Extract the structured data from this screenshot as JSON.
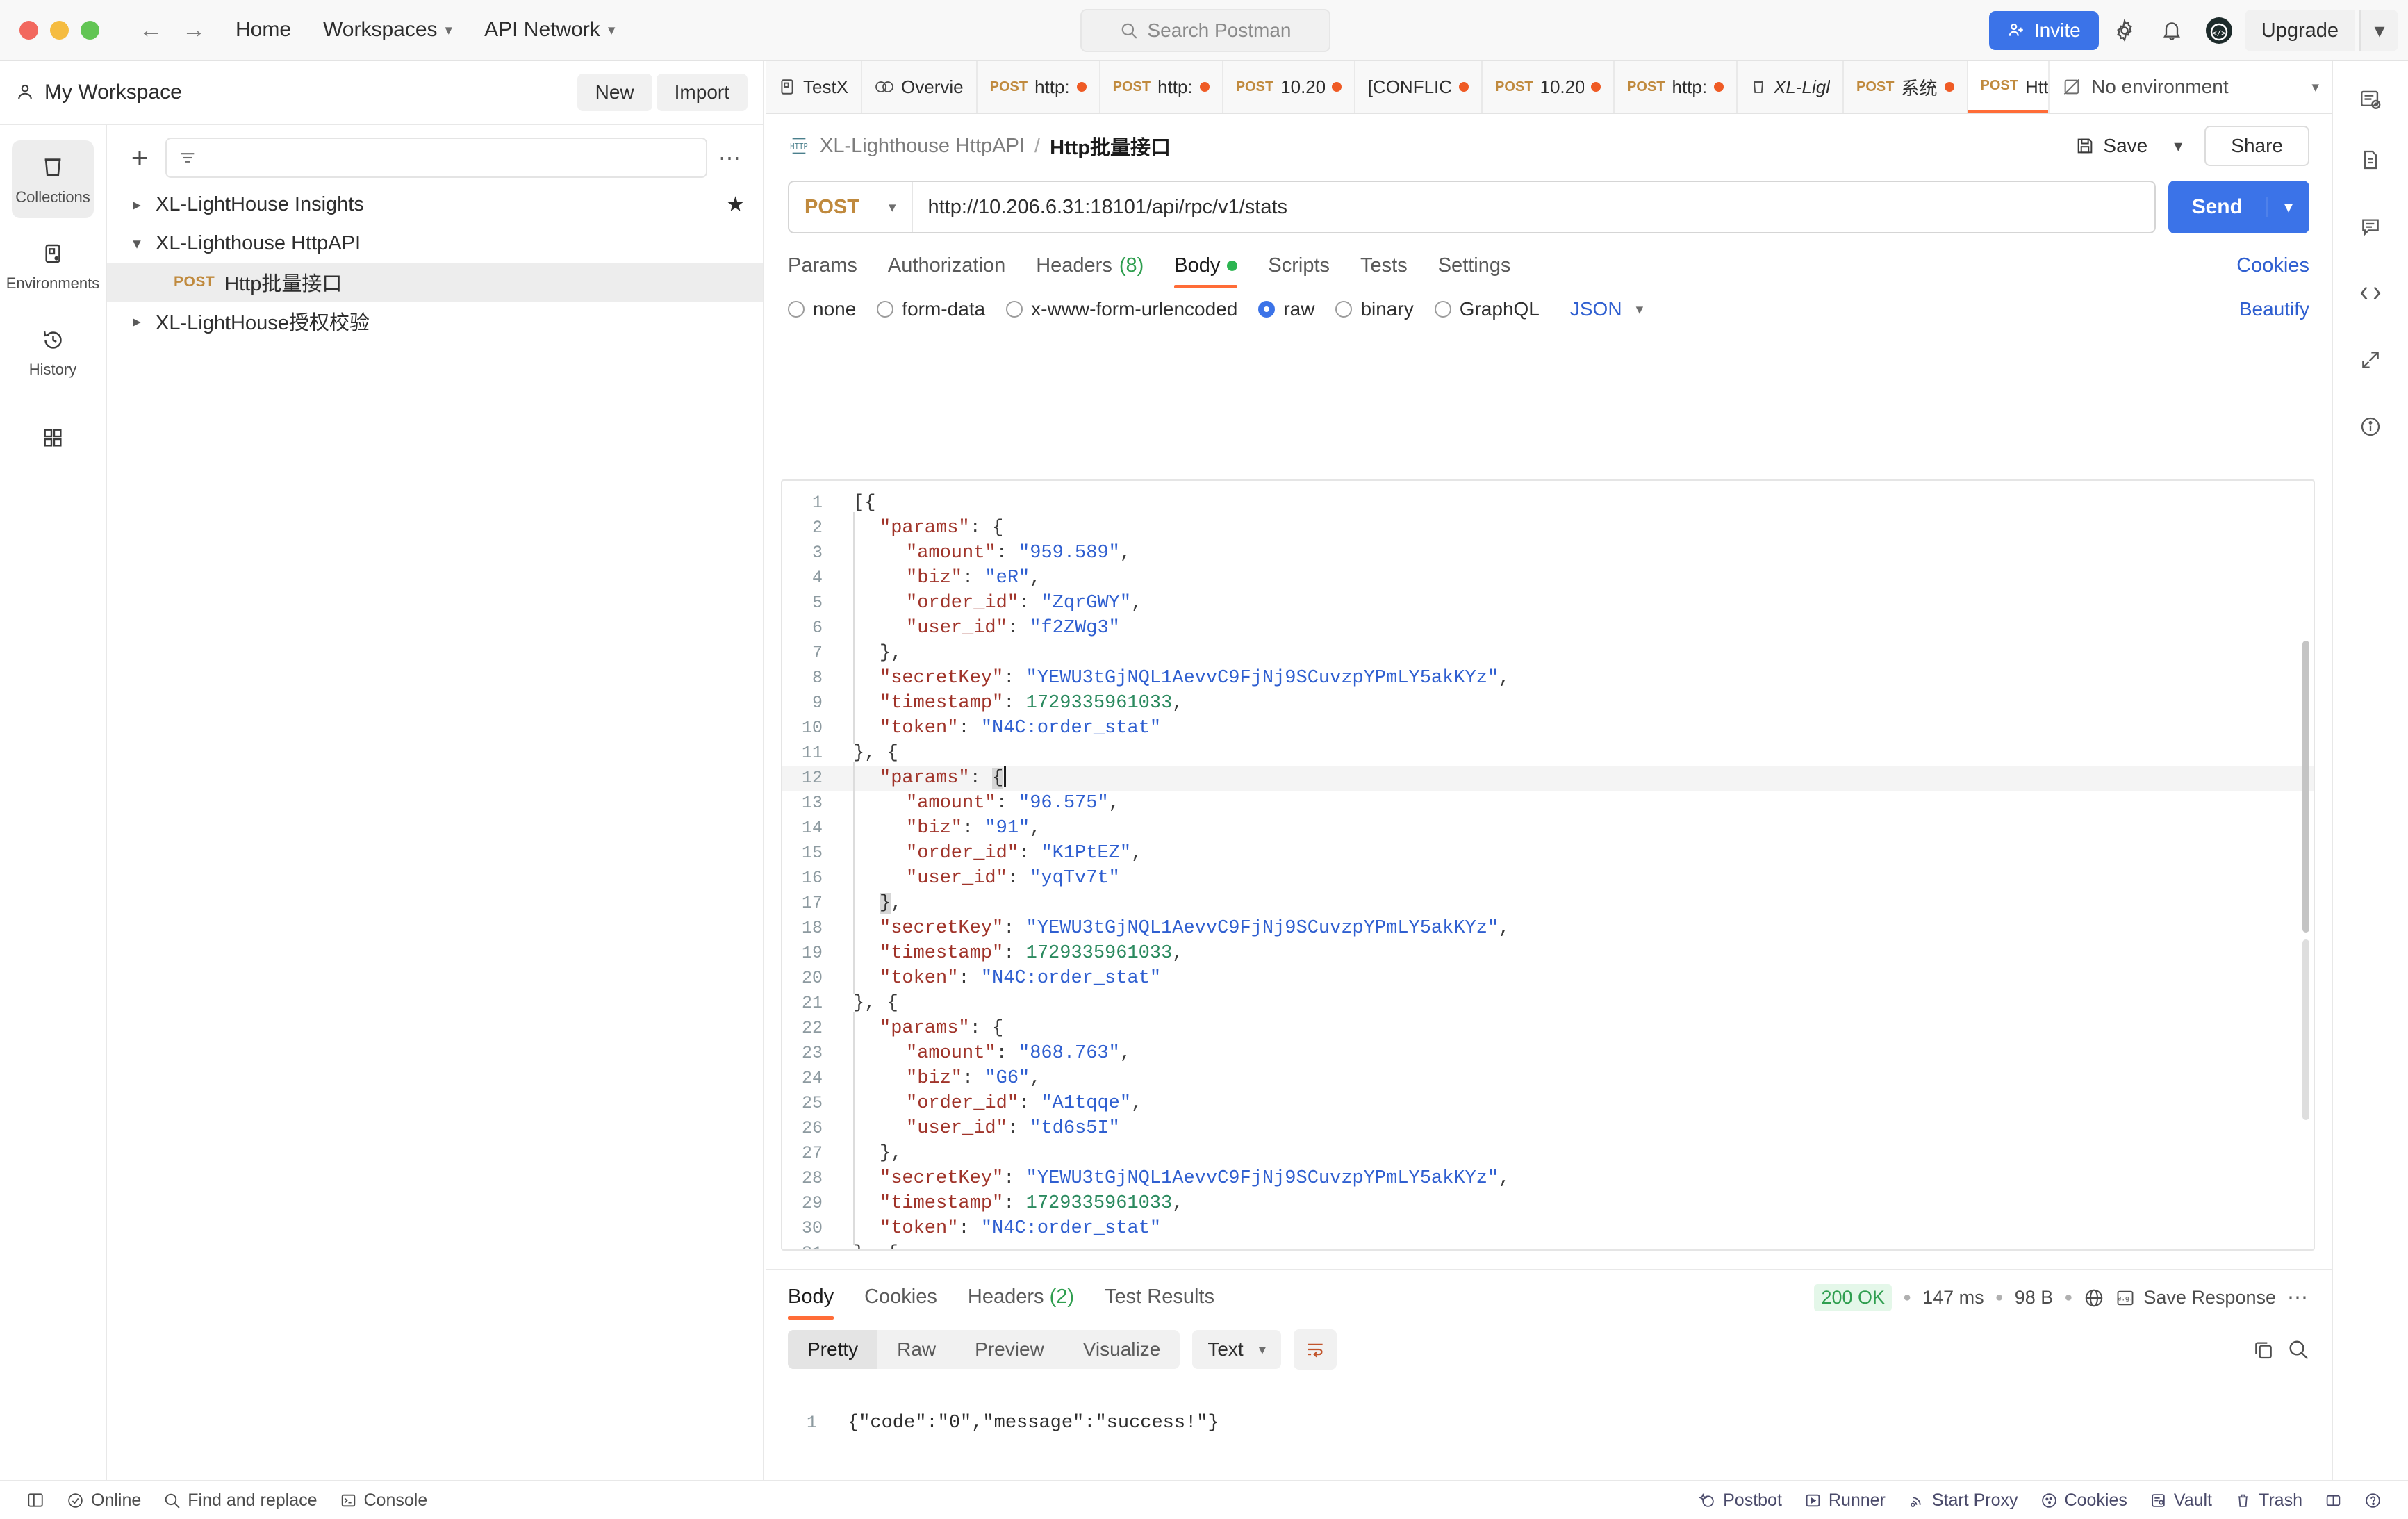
{
  "topbar": {
    "nav_back": "back-arrow",
    "nav_forward": "forward-arrow",
    "home": "Home",
    "workspaces": "Workspaces",
    "api_network": "API Network",
    "search_placeholder": "Search Postman",
    "invite": "Invite",
    "upgrade": "Upgrade"
  },
  "sidebar": {
    "workspace": "My Workspace",
    "new_button": "New",
    "import_button": "Import",
    "rail": [
      {
        "label": "Collections",
        "icon": "collections-icon",
        "active": true
      },
      {
        "label": "Environments",
        "icon": "environments-icon",
        "active": false
      },
      {
        "label": "History",
        "icon": "history-icon",
        "active": false
      },
      {
        "label": "",
        "icon": "apps-icon",
        "active": false
      }
    ],
    "filter_placeholder": "",
    "tree": [
      {
        "type": "collection",
        "label": "XL-LightHouse Insights",
        "expanded": false,
        "starred": true,
        "selected": false
      },
      {
        "type": "collection",
        "label": "XL-Lighthouse HttpAPI",
        "expanded": true,
        "starred": false,
        "selected": false
      },
      {
        "type": "request",
        "method": "POST",
        "label": "Http批量接口",
        "selected": true
      },
      {
        "type": "collection",
        "label": "XL-LightHouse授权校验",
        "expanded": false,
        "starred": false,
        "selected": false
      }
    ]
  },
  "tabs": [
    {
      "icon": "request-icon",
      "method": "",
      "label": "TestX",
      "dirty": false,
      "active": false
    },
    {
      "icon": "overview-icon",
      "method": "",
      "label": "Overvie",
      "dirty": false,
      "active": false
    },
    {
      "icon": "",
      "method": "POST",
      "label": "http:",
      "dirty": true,
      "active": false
    },
    {
      "icon": "",
      "method": "POST",
      "label": "http:",
      "dirty": true,
      "active": false
    },
    {
      "icon": "",
      "method": "POST",
      "label": "10.20",
      "dirty": true,
      "active": false
    },
    {
      "icon": "",
      "method": "",
      "label": "[CONFLIC",
      "dirty": true,
      "active": false
    },
    {
      "icon": "",
      "method": "POST",
      "label": "10.20",
      "dirty": true,
      "active": false
    },
    {
      "icon": "",
      "method": "POST",
      "label": "http:",
      "dirty": true,
      "active": false
    },
    {
      "icon": "collection-icon",
      "method": "",
      "label": "XL-Ligl",
      "dirty": false,
      "active": false
    },
    {
      "icon": "",
      "method": "POST",
      "label": "系统",
      "dirty": true,
      "active": false
    },
    {
      "icon": "",
      "method": "POST",
      "label": "Http批",
      "dirty": true,
      "active": true
    }
  ],
  "environment": {
    "label": "No environment"
  },
  "request": {
    "breadcrumb_collection": "XL-Lighthouse HttpAPI",
    "breadcrumb_separator": "/",
    "breadcrumb_request": "Http批量接口",
    "save_label": "Save",
    "share_label": "Share",
    "method": "POST",
    "url": "http://10.206.6.31:18101/api/rpc/v1/stats",
    "send_label": "Send",
    "tabs": [
      {
        "label": "Params",
        "active": false
      },
      {
        "label": "Authorization",
        "active": false
      },
      {
        "label": "Headers",
        "count": "(8)",
        "active": false
      },
      {
        "label": "Body",
        "dirty": true,
        "active": true
      },
      {
        "label": "Scripts",
        "active": false
      },
      {
        "label": "Tests",
        "active": false
      },
      {
        "label": "Settings",
        "active": false
      }
    ],
    "cookies_link": "Cookies",
    "body_types": [
      {
        "label": "none",
        "selected": false
      },
      {
        "label": "form-data",
        "selected": false
      },
      {
        "label": "x-www-form-urlencoded",
        "selected": false
      },
      {
        "label": "raw",
        "selected": true
      },
      {
        "label": "binary",
        "selected": false
      },
      {
        "label": "GraphQL",
        "selected": false
      }
    ],
    "raw_format": "JSON",
    "beautify_label": "Beautify"
  },
  "body_code": [
    {
      "n": 1,
      "indent": 0,
      "guide": false,
      "tokens": [
        {
          "t": "p",
          "v": "[{"
        }
      ]
    },
    {
      "n": 2,
      "indent": 1,
      "guide": true,
      "tokens": [
        {
          "t": "k",
          "v": "\"params\""
        },
        {
          "t": "p",
          "v": ": {"
        }
      ]
    },
    {
      "n": 3,
      "indent": 2,
      "guide": true,
      "tokens": [
        {
          "t": "k",
          "v": "\"amount\""
        },
        {
          "t": "p",
          "v": ": "
        },
        {
          "t": "s",
          "v": "\"959.589\""
        },
        {
          "t": "p",
          "v": ","
        }
      ]
    },
    {
      "n": 4,
      "indent": 2,
      "guide": true,
      "tokens": [
        {
          "t": "k",
          "v": "\"biz\""
        },
        {
          "t": "p",
          "v": ": "
        },
        {
          "t": "s",
          "v": "\"eR\""
        },
        {
          "t": "p",
          "v": ","
        }
      ]
    },
    {
      "n": 5,
      "indent": 2,
      "guide": true,
      "tokens": [
        {
          "t": "k",
          "v": "\"order_id\""
        },
        {
          "t": "p",
          "v": ": "
        },
        {
          "t": "s",
          "v": "\"ZqrGWY\""
        },
        {
          "t": "p",
          "v": ","
        }
      ]
    },
    {
      "n": 6,
      "indent": 2,
      "guide": true,
      "tokens": [
        {
          "t": "k",
          "v": "\"user_id\""
        },
        {
          "t": "p",
          "v": ": "
        },
        {
          "t": "s",
          "v": "\"f2ZWg3\""
        }
      ]
    },
    {
      "n": 7,
      "indent": 1,
      "guide": true,
      "tokens": [
        {
          "t": "p",
          "v": "},"
        }
      ]
    },
    {
      "n": 8,
      "indent": 1,
      "guide": true,
      "tokens": [
        {
          "t": "k",
          "v": "\"secretKey\""
        },
        {
          "t": "p",
          "v": ": "
        },
        {
          "t": "s",
          "v": "\"YEWU3tGjNQL1AevvC9FjNj9SCuvzpYPmLY5akKYz\""
        },
        {
          "t": "p",
          "v": ","
        }
      ]
    },
    {
      "n": 9,
      "indent": 1,
      "guide": true,
      "tokens": [
        {
          "t": "k",
          "v": "\"timestamp\""
        },
        {
          "t": "p",
          "v": ": "
        },
        {
          "t": "n",
          "v": "1729335961033"
        },
        {
          "t": "p",
          "v": ","
        }
      ]
    },
    {
      "n": 10,
      "indent": 1,
      "guide": true,
      "tokens": [
        {
          "t": "k",
          "v": "\"token\""
        },
        {
          "t": "p",
          "v": ": "
        },
        {
          "t": "s",
          "v": "\"N4C:order_stat\""
        }
      ]
    },
    {
      "n": 11,
      "indent": 0,
      "guide": false,
      "tokens": [
        {
          "t": "p",
          "v": "}, {"
        }
      ]
    },
    {
      "n": 12,
      "indent": 1,
      "guide": true,
      "highlight": true,
      "cursor": true,
      "tokens": [
        {
          "t": "k",
          "v": "\"params\""
        },
        {
          "t": "p",
          "v": ": "
        },
        {
          "t": "sel",
          "v": "{"
        }
      ]
    },
    {
      "n": 13,
      "indent": 2,
      "guide": true,
      "tokens": [
        {
          "t": "k",
          "v": "\"amount\""
        },
        {
          "t": "p",
          "v": ": "
        },
        {
          "t": "s",
          "v": "\"96.575\""
        },
        {
          "t": "p",
          "v": ","
        }
      ]
    },
    {
      "n": 14,
      "indent": 2,
      "guide": true,
      "tokens": [
        {
          "t": "k",
          "v": "\"biz\""
        },
        {
          "t": "p",
          "v": ": "
        },
        {
          "t": "s",
          "v": "\"91\""
        },
        {
          "t": "p",
          "v": ","
        }
      ]
    },
    {
      "n": 15,
      "indent": 2,
      "guide": true,
      "tokens": [
        {
          "t": "k",
          "v": "\"order_id\""
        },
        {
          "t": "p",
          "v": ": "
        },
        {
          "t": "s",
          "v": "\"K1PtEZ\""
        },
        {
          "t": "p",
          "v": ","
        }
      ]
    },
    {
      "n": 16,
      "indent": 2,
      "guide": true,
      "tokens": [
        {
          "t": "k",
          "v": "\"user_id\""
        },
        {
          "t": "p",
          "v": ": "
        },
        {
          "t": "s",
          "v": "\"yqTv7t\""
        }
      ]
    },
    {
      "n": 17,
      "indent": 1,
      "guide": true,
      "tokens": [
        {
          "t": "sel",
          "v": "}"
        },
        {
          "t": "p",
          "v": ","
        }
      ]
    },
    {
      "n": 18,
      "indent": 1,
      "guide": true,
      "tokens": [
        {
          "t": "k",
          "v": "\"secretKey\""
        },
        {
          "t": "p",
          "v": ": "
        },
        {
          "t": "s",
          "v": "\"YEWU3tGjNQL1AevvC9FjNj9SCuvzpYPmLY5akKYz\""
        },
        {
          "t": "p",
          "v": ","
        }
      ]
    },
    {
      "n": 19,
      "indent": 1,
      "guide": true,
      "tokens": [
        {
          "t": "k",
          "v": "\"timestamp\""
        },
        {
          "t": "p",
          "v": ": "
        },
        {
          "t": "n",
          "v": "1729335961033"
        },
        {
          "t": "p",
          "v": ","
        }
      ]
    },
    {
      "n": 20,
      "indent": 1,
      "guide": true,
      "tokens": [
        {
          "t": "k",
          "v": "\"token\""
        },
        {
          "t": "p",
          "v": ": "
        },
        {
          "t": "s",
          "v": "\"N4C:order_stat\""
        }
      ]
    },
    {
      "n": 21,
      "indent": 0,
      "guide": false,
      "tokens": [
        {
          "t": "p",
          "v": "}, {"
        }
      ]
    },
    {
      "n": 22,
      "indent": 1,
      "guide": true,
      "tokens": [
        {
          "t": "k",
          "v": "\"params\""
        },
        {
          "t": "p",
          "v": ": {"
        }
      ]
    },
    {
      "n": 23,
      "indent": 2,
      "guide": true,
      "tokens": [
        {
          "t": "k",
          "v": "\"amount\""
        },
        {
          "t": "p",
          "v": ": "
        },
        {
          "t": "s",
          "v": "\"868.763\""
        },
        {
          "t": "p",
          "v": ","
        }
      ]
    },
    {
      "n": 24,
      "indent": 2,
      "guide": true,
      "tokens": [
        {
          "t": "k",
          "v": "\"biz\""
        },
        {
          "t": "p",
          "v": ": "
        },
        {
          "t": "s",
          "v": "\"G6\""
        },
        {
          "t": "p",
          "v": ","
        }
      ]
    },
    {
      "n": 25,
      "indent": 2,
      "guide": true,
      "tokens": [
        {
          "t": "k",
          "v": "\"order_id\""
        },
        {
          "t": "p",
          "v": ": "
        },
        {
          "t": "s",
          "v": "\"A1tqqe\""
        },
        {
          "t": "p",
          "v": ","
        }
      ]
    },
    {
      "n": 26,
      "indent": 2,
      "guide": true,
      "tokens": [
        {
          "t": "k",
          "v": "\"user_id\""
        },
        {
          "t": "p",
          "v": ": "
        },
        {
          "t": "s",
          "v": "\"td6s5I\""
        }
      ]
    },
    {
      "n": 27,
      "indent": 1,
      "guide": true,
      "tokens": [
        {
          "t": "p",
          "v": "},"
        }
      ]
    },
    {
      "n": 28,
      "indent": 1,
      "guide": true,
      "tokens": [
        {
          "t": "k",
          "v": "\"secretKey\""
        },
        {
          "t": "p",
          "v": ": "
        },
        {
          "t": "s",
          "v": "\"YEWU3tGjNQL1AevvC9FjNj9SCuvzpYPmLY5akKYz\""
        },
        {
          "t": "p",
          "v": ","
        }
      ]
    },
    {
      "n": 29,
      "indent": 1,
      "guide": true,
      "tokens": [
        {
          "t": "k",
          "v": "\"timestamp\""
        },
        {
          "t": "p",
          "v": ": "
        },
        {
          "t": "n",
          "v": "1729335961033"
        },
        {
          "t": "p",
          "v": ","
        }
      ]
    },
    {
      "n": 30,
      "indent": 1,
      "guide": true,
      "tokens": [
        {
          "t": "k",
          "v": "\"token\""
        },
        {
          "t": "p",
          "v": ": "
        },
        {
          "t": "s",
          "v": "\"N4C:order_stat\""
        }
      ]
    },
    {
      "n": 31,
      "indent": 0,
      "guide": false,
      "tokens": [
        {
          "t": "p",
          "v": "}, {"
        }
      ]
    }
  ],
  "response": {
    "tabs": [
      {
        "label": "Body",
        "active": true
      },
      {
        "label": "Cookies",
        "active": false
      },
      {
        "label": "Headers",
        "count": "(2)",
        "active": false
      },
      {
        "label": "Test Results",
        "active": false
      }
    ],
    "status": "200 OK",
    "time": "147 ms",
    "size": "98 B",
    "save_response": "Save Response",
    "formats": [
      {
        "label": "Pretty",
        "active": true
      },
      {
        "label": "Raw",
        "active": false
      },
      {
        "label": "Preview",
        "active": false
      },
      {
        "label": "Visualize",
        "active": false
      }
    ],
    "type": "Text",
    "body_lines": [
      {
        "n": 1,
        "text": "{\"code\":\"0\",\"message\":\"success!\"}"
      }
    ]
  },
  "statusbar": {
    "left": [
      {
        "label": "Online",
        "icon": "check-circle-icon"
      },
      {
        "label": "Find and replace",
        "icon": "search-icon"
      },
      {
        "label": "Console",
        "icon": "console-icon"
      }
    ],
    "right": [
      {
        "label": "Postbot",
        "icon": "postbot-icon"
      },
      {
        "label": "Runner",
        "icon": "runner-icon"
      },
      {
        "label": "Start Proxy",
        "icon": "proxy-icon"
      },
      {
        "label": "Cookies",
        "icon": "cookies-icon"
      },
      {
        "label": "Vault",
        "icon": "vault-icon"
      },
      {
        "label": "Trash",
        "icon": "trash-icon"
      }
    ]
  },
  "colors": {
    "accent": "#ff6c37",
    "primary": "#3b73e8",
    "success": "#2f9e4f",
    "method_post": "#c08a3e"
  }
}
